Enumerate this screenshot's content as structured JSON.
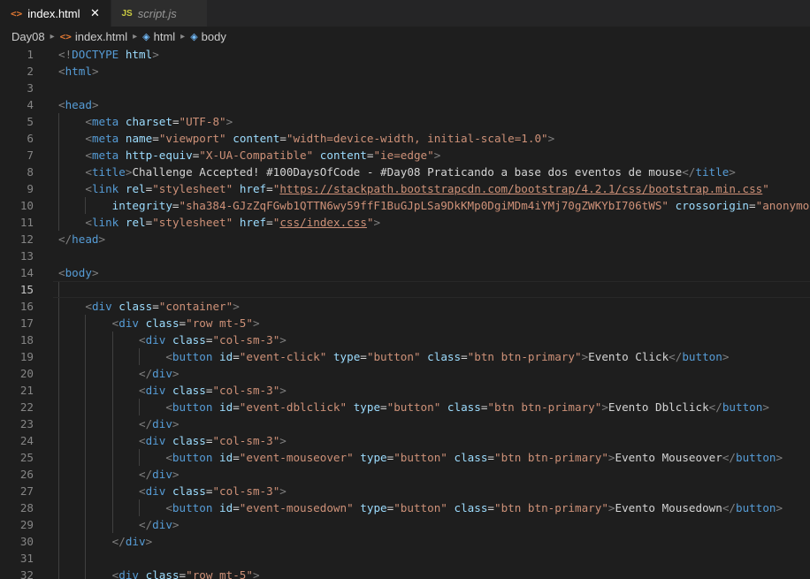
{
  "tabs": [
    {
      "label": "index.html",
      "icon": "html-file-icon",
      "active": true
    },
    {
      "label": "script.js",
      "icon": "js-file-icon",
      "active": false
    }
  ],
  "breadcrumb": [
    {
      "label": "Day08",
      "icon": ""
    },
    {
      "label": "index.html",
      "icon": "html-file-icon"
    },
    {
      "label": "html",
      "icon": "cube-icon"
    },
    {
      "label": "body",
      "icon": "cube-icon"
    }
  ],
  "editor": {
    "current_line": 15,
    "lines": [
      {
        "n": "1",
        "indent": 0,
        "tokens": [
          [
            "p",
            "<!"
          ],
          [
            "t",
            "DOCTYPE"
          ],
          [
            "e",
            " "
          ],
          [
            "a",
            "html"
          ],
          [
            "p",
            ">"
          ]
        ]
      },
      {
        "n": "2",
        "indent": 0,
        "tokens": [
          [
            "p",
            "<"
          ],
          [
            "t",
            "html"
          ],
          [
            "p",
            ">"
          ]
        ]
      },
      {
        "n": "3",
        "indent": 0,
        "tokens": []
      },
      {
        "n": "4",
        "indent": 0,
        "tokens": [
          [
            "p",
            "<"
          ],
          [
            "t",
            "head"
          ],
          [
            "p",
            ">"
          ]
        ]
      },
      {
        "n": "5",
        "indent": 1,
        "tokens": [
          [
            "p",
            "<"
          ],
          [
            "t",
            "meta"
          ],
          [
            "e",
            " "
          ],
          [
            "a",
            "charset"
          ],
          [
            "e",
            "="
          ],
          [
            "s",
            "\"UTF-8\""
          ],
          [
            "p",
            ">"
          ]
        ]
      },
      {
        "n": "6",
        "indent": 1,
        "tokens": [
          [
            "p",
            "<"
          ],
          [
            "t",
            "meta"
          ],
          [
            "e",
            " "
          ],
          [
            "a",
            "name"
          ],
          [
            "e",
            "="
          ],
          [
            "s",
            "\"viewport\""
          ],
          [
            "e",
            " "
          ],
          [
            "a",
            "content"
          ],
          [
            "e",
            "="
          ],
          [
            "s",
            "\"width=device-width, initial-scale=1.0\""
          ],
          [
            "p",
            ">"
          ]
        ]
      },
      {
        "n": "7",
        "indent": 1,
        "tokens": [
          [
            "p",
            "<"
          ],
          [
            "t",
            "meta"
          ],
          [
            "e",
            " "
          ],
          [
            "a",
            "http-equiv"
          ],
          [
            "e",
            "="
          ],
          [
            "s",
            "\"X-UA-Compatible\""
          ],
          [
            "e",
            " "
          ],
          [
            "a",
            "content"
          ],
          [
            "e",
            "="
          ],
          [
            "s",
            "\"ie=edge\""
          ],
          [
            "p",
            ">"
          ]
        ]
      },
      {
        "n": "8",
        "indent": 1,
        "tokens": [
          [
            "p",
            "<"
          ],
          [
            "t",
            "title"
          ],
          [
            "p",
            ">"
          ],
          [
            "x",
            "Challenge Accepted! #100DaysOfCode - #Day08 Praticando a base dos eventos de mouse"
          ],
          [
            "p",
            "</"
          ],
          [
            "t",
            "title"
          ],
          [
            "p",
            ">"
          ]
        ]
      },
      {
        "n": "9",
        "indent": 1,
        "tokens": [
          [
            "p",
            "<"
          ],
          [
            "t",
            "link"
          ],
          [
            "e",
            " "
          ],
          [
            "a",
            "rel"
          ],
          [
            "e",
            "="
          ],
          [
            "s",
            "\"stylesheet\""
          ],
          [
            "e",
            " "
          ],
          [
            "a",
            "href"
          ],
          [
            "e",
            "="
          ],
          [
            "s",
            "\""
          ],
          [
            "su",
            "https://stackpath.bootstrapcdn.com/bootstrap/4.2.1/css/bootstrap.min.css"
          ],
          [
            "s",
            "\""
          ]
        ]
      },
      {
        "n": "10",
        "indent": 2,
        "tokens": [
          [
            "a",
            "integrity"
          ],
          [
            "e",
            "="
          ],
          [
            "s",
            "\"sha384-GJzZqFGwb1QTTN6wy59ffF1BuGJpLSa9DkKMp0DgiMDm4iYMj70gZWKYbI706tWS\""
          ],
          [
            "e",
            " "
          ],
          [
            "a",
            "crossorigin"
          ],
          [
            "e",
            "="
          ],
          [
            "s",
            "\"anonymous\""
          ],
          [
            "p",
            ">"
          ]
        ]
      },
      {
        "n": "11",
        "indent": 1,
        "tokens": [
          [
            "p",
            "<"
          ],
          [
            "t",
            "link"
          ],
          [
            "e",
            " "
          ],
          [
            "a",
            "rel"
          ],
          [
            "e",
            "="
          ],
          [
            "s",
            "\"stylesheet\""
          ],
          [
            "e",
            " "
          ],
          [
            "a",
            "href"
          ],
          [
            "e",
            "="
          ],
          [
            "s",
            "\""
          ],
          [
            "su",
            "css/index.css"
          ],
          [
            "s",
            "\""
          ],
          [
            "p",
            ">"
          ]
        ]
      },
      {
        "n": "12",
        "indent": 0,
        "tokens": [
          [
            "p",
            "</"
          ],
          [
            "t",
            "head"
          ],
          [
            "p",
            ">"
          ]
        ]
      },
      {
        "n": "13",
        "indent": 0,
        "tokens": []
      },
      {
        "n": "14",
        "indent": 0,
        "tokens": [
          [
            "p",
            "<"
          ],
          [
            "t",
            "body"
          ],
          [
            "p",
            ">"
          ]
        ]
      },
      {
        "n": "15",
        "indent": 1,
        "tokens": []
      },
      {
        "n": "16",
        "indent": 1,
        "tokens": [
          [
            "p",
            "<"
          ],
          [
            "t",
            "div"
          ],
          [
            "e",
            " "
          ],
          [
            "a",
            "class"
          ],
          [
            "e",
            "="
          ],
          [
            "s",
            "\"container\""
          ],
          [
            "p",
            ">"
          ]
        ]
      },
      {
        "n": "17",
        "indent": 2,
        "tokens": [
          [
            "p",
            "<"
          ],
          [
            "t",
            "div"
          ],
          [
            "e",
            " "
          ],
          [
            "a",
            "class"
          ],
          [
            "e",
            "="
          ],
          [
            "s",
            "\"row mt-5\""
          ],
          [
            "p",
            ">"
          ]
        ]
      },
      {
        "n": "18",
        "indent": 3,
        "tokens": [
          [
            "p",
            "<"
          ],
          [
            "t",
            "div"
          ],
          [
            "e",
            " "
          ],
          [
            "a",
            "class"
          ],
          [
            "e",
            "="
          ],
          [
            "s",
            "\"col-sm-3\""
          ],
          [
            "p",
            ">"
          ]
        ]
      },
      {
        "n": "19",
        "indent": 4,
        "tokens": [
          [
            "p",
            "<"
          ],
          [
            "t",
            "button"
          ],
          [
            "e",
            " "
          ],
          [
            "a",
            "id"
          ],
          [
            "e",
            "="
          ],
          [
            "s",
            "\"event-click\""
          ],
          [
            "e",
            " "
          ],
          [
            "a",
            "type"
          ],
          [
            "e",
            "="
          ],
          [
            "s",
            "\"button\""
          ],
          [
            "e",
            " "
          ],
          [
            "a",
            "class"
          ],
          [
            "e",
            "="
          ],
          [
            "s",
            "\"btn btn-primary\""
          ],
          [
            "p",
            ">"
          ],
          [
            "x",
            "Evento Click"
          ],
          [
            "p",
            "</"
          ],
          [
            "t",
            "button"
          ],
          [
            "p",
            ">"
          ]
        ]
      },
      {
        "n": "20",
        "indent": 3,
        "tokens": [
          [
            "p",
            "</"
          ],
          [
            "t",
            "div"
          ],
          [
            "p",
            ">"
          ]
        ]
      },
      {
        "n": "21",
        "indent": 3,
        "tokens": [
          [
            "p",
            "<"
          ],
          [
            "t",
            "div"
          ],
          [
            "e",
            " "
          ],
          [
            "a",
            "class"
          ],
          [
            "e",
            "="
          ],
          [
            "s",
            "\"col-sm-3\""
          ],
          [
            "p",
            ">"
          ]
        ]
      },
      {
        "n": "22",
        "indent": 4,
        "tokens": [
          [
            "p",
            "<"
          ],
          [
            "t",
            "button"
          ],
          [
            "e",
            " "
          ],
          [
            "a",
            "id"
          ],
          [
            "e",
            "="
          ],
          [
            "s",
            "\"event-dblclick\""
          ],
          [
            "e",
            " "
          ],
          [
            "a",
            "type"
          ],
          [
            "e",
            "="
          ],
          [
            "s",
            "\"button\""
          ],
          [
            "e",
            " "
          ],
          [
            "a",
            "class"
          ],
          [
            "e",
            "="
          ],
          [
            "s",
            "\"btn btn-primary\""
          ],
          [
            "p",
            ">"
          ],
          [
            "x",
            "Evento Dblclick"
          ],
          [
            "p",
            "</"
          ],
          [
            "t",
            "button"
          ],
          [
            "p",
            ">"
          ]
        ]
      },
      {
        "n": "23",
        "indent": 3,
        "tokens": [
          [
            "p",
            "</"
          ],
          [
            "t",
            "div"
          ],
          [
            "p",
            ">"
          ]
        ]
      },
      {
        "n": "24",
        "indent": 3,
        "tokens": [
          [
            "p",
            "<"
          ],
          [
            "t",
            "div"
          ],
          [
            "e",
            " "
          ],
          [
            "a",
            "class"
          ],
          [
            "e",
            "="
          ],
          [
            "s",
            "\"col-sm-3\""
          ],
          [
            "p",
            ">"
          ]
        ]
      },
      {
        "n": "25",
        "indent": 4,
        "tokens": [
          [
            "p",
            "<"
          ],
          [
            "t",
            "button"
          ],
          [
            "e",
            " "
          ],
          [
            "a",
            "id"
          ],
          [
            "e",
            "="
          ],
          [
            "s",
            "\"event-mouseover\""
          ],
          [
            "e",
            " "
          ],
          [
            "a",
            "type"
          ],
          [
            "e",
            "="
          ],
          [
            "s",
            "\"button\""
          ],
          [
            "e",
            " "
          ],
          [
            "a",
            "class"
          ],
          [
            "e",
            "="
          ],
          [
            "s",
            "\"btn btn-primary\""
          ],
          [
            "p",
            ">"
          ],
          [
            "x",
            "Evento Mouseover"
          ],
          [
            "p",
            "</"
          ],
          [
            "t",
            "button"
          ],
          [
            "p",
            ">"
          ]
        ]
      },
      {
        "n": "26",
        "indent": 3,
        "tokens": [
          [
            "p",
            "</"
          ],
          [
            "t",
            "div"
          ],
          [
            "p",
            ">"
          ]
        ]
      },
      {
        "n": "27",
        "indent": 3,
        "tokens": [
          [
            "p",
            "<"
          ],
          [
            "t",
            "div"
          ],
          [
            "e",
            " "
          ],
          [
            "a",
            "class"
          ],
          [
            "e",
            "="
          ],
          [
            "s",
            "\"col-sm-3\""
          ],
          [
            "p",
            ">"
          ]
        ]
      },
      {
        "n": "28",
        "indent": 4,
        "tokens": [
          [
            "p",
            "<"
          ],
          [
            "t",
            "button"
          ],
          [
            "e",
            " "
          ],
          [
            "a",
            "id"
          ],
          [
            "e",
            "="
          ],
          [
            "s",
            "\"event-mousedown\""
          ],
          [
            "e",
            " "
          ],
          [
            "a",
            "type"
          ],
          [
            "e",
            "="
          ],
          [
            "s",
            "\"button\""
          ],
          [
            "e",
            " "
          ],
          [
            "a",
            "class"
          ],
          [
            "e",
            "="
          ],
          [
            "s",
            "\"btn btn-primary\""
          ],
          [
            "p",
            ">"
          ],
          [
            "x",
            "Evento Mousedown"
          ],
          [
            "p",
            "</"
          ],
          [
            "t",
            "button"
          ],
          [
            "p",
            ">"
          ]
        ]
      },
      {
        "n": "29",
        "indent": 3,
        "tokens": [
          [
            "p",
            "</"
          ],
          [
            "t",
            "div"
          ],
          [
            "p",
            ">"
          ]
        ]
      },
      {
        "n": "30",
        "indent": 2,
        "tokens": [
          [
            "p",
            "</"
          ],
          [
            "t",
            "div"
          ],
          [
            "p",
            ">"
          ]
        ]
      },
      {
        "n": "31",
        "indent": 2,
        "tokens": []
      },
      {
        "n": "32",
        "indent": 2,
        "tokens": [
          [
            "p",
            "<"
          ],
          [
            "t",
            "div"
          ],
          [
            "e",
            " "
          ],
          [
            "a",
            "class"
          ],
          [
            "e",
            "="
          ],
          [
            "s",
            "\"row mt-5\""
          ],
          [
            "p",
            ">"
          ]
        ]
      }
    ]
  }
}
